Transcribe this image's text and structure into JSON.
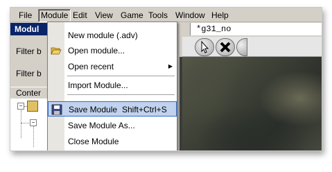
{
  "menubar": {
    "items": [
      "File",
      "Module",
      "Edit",
      "View",
      "Game",
      "Tools",
      "Window",
      "Help"
    ],
    "active": "Module"
  },
  "panel": {
    "title": "Modul",
    "close_glyph": "×",
    "filter1_label": "Filter b",
    "filter2_label": "Filter b",
    "tab_label": "Conter",
    "expander_minus": "−"
  },
  "document": {
    "tab_title": "*g31_no"
  },
  "dropdown": {
    "items": [
      {
        "label": "New module (.adv)",
        "shortcut": "",
        "icon": "",
        "submenu": false
      },
      {
        "label": "Open module...",
        "shortcut": "",
        "icon": "folder-open-icon",
        "submenu": false
      },
      {
        "label": "Open recent",
        "shortcut": "",
        "icon": "",
        "submenu": true
      },
      {
        "label": "Import Module...",
        "shortcut": "",
        "icon": "",
        "submenu": false
      },
      {
        "label": "Save Module",
        "shortcut": "Shift+Ctrl+S",
        "icon": "save-icon",
        "submenu": false,
        "highlighted": true
      },
      {
        "label": "Save Module As...",
        "shortcut": "",
        "icon": "",
        "submenu": false
      },
      {
        "label": "Close Module",
        "shortcut": "",
        "icon": "",
        "submenu": false
      }
    ],
    "submenu_glyph": "▶"
  },
  "colors": {
    "panel_title_bg": "#0a246a",
    "menu_highlight_bg": "#c1d2ee",
    "menu_highlight_border": "#316ac5"
  }
}
